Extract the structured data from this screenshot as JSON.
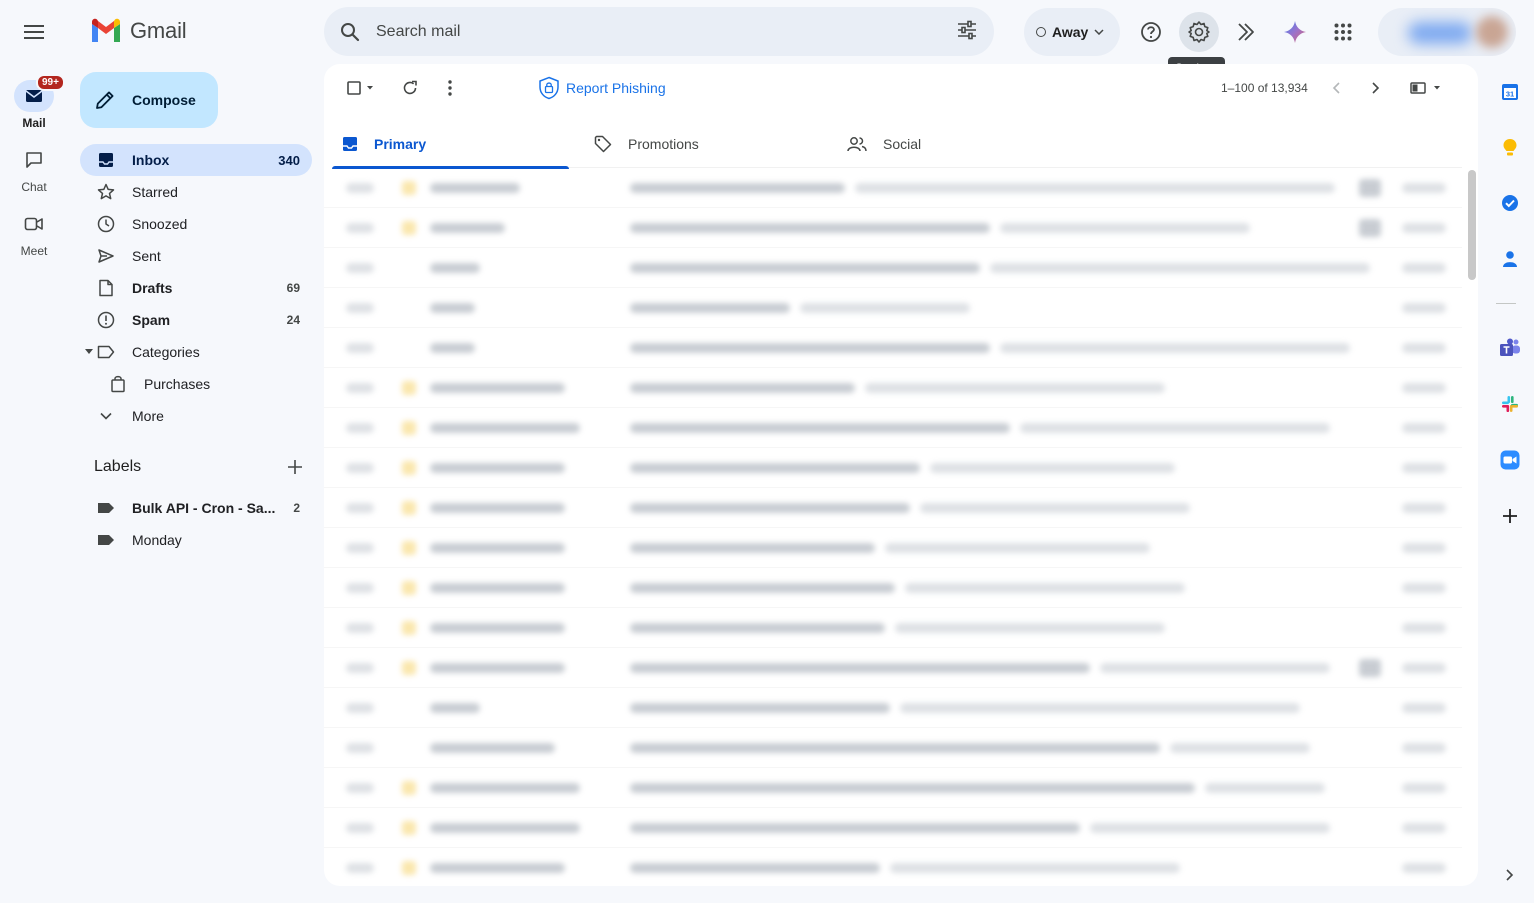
{
  "app": {
    "name": "Gmail"
  },
  "rail": {
    "mail": {
      "label": "Mail",
      "badge": "99+"
    },
    "chat": {
      "label": "Chat"
    },
    "meet": {
      "label": "Meet"
    }
  },
  "search": {
    "placeholder": "Search mail",
    "value": ""
  },
  "header": {
    "status_label": "Away",
    "settings_tooltip": "Settings"
  },
  "compose": {
    "label": "Compose"
  },
  "nav": {
    "items": [
      {
        "label": "Inbox",
        "count": "340",
        "icon": "inbox-icon",
        "active": true
      },
      {
        "label": "Starred",
        "count": "",
        "icon": "star-icon"
      },
      {
        "label": "Snoozed",
        "count": "",
        "icon": "clock-icon"
      },
      {
        "label": "Sent",
        "count": "",
        "icon": "send-icon"
      },
      {
        "label": "Drafts",
        "count": "69",
        "icon": "draft-icon"
      },
      {
        "label": "Spam",
        "count": "24",
        "icon": "spam-icon"
      },
      {
        "label": "Categories",
        "count": "",
        "icon": "label-outline-icon"
      },
      {
        "label": "Purchases",
        "count": "",
        "icon": "shopping-bag-icon"
      },
      {
        "label": "More",
        "count": "",
        "icon": "chevron-down-icon"
      }
    ]
  },
  "labels": {
    "title": "Labels",
    "items": [
      {
        "label": "Bulk API - Cron - Sa...",
        "count": "2"
      },
      {
        "label": "Monday",
        "count": ""
      }
    ]
  },
  "toolbar": {
    "report_phishing": "Report Phishing",
    "pagination": "1–100 of 13,934"
  },
  "tabs": [
    {
      "label": "Primary",
      "active": true
    },
    {
      "label": "Promotions"
    },
    {
      "label": "Social"
    }
  ],
  "colors": {
    "accent": "#0b57d0",
    "compose_bg": "#c2e7ff",
    "nav_active_bg": "#d3e3fd",
    "page_bg": "#f6f8fc",
    "badge": "#b3261e"
  }
}
